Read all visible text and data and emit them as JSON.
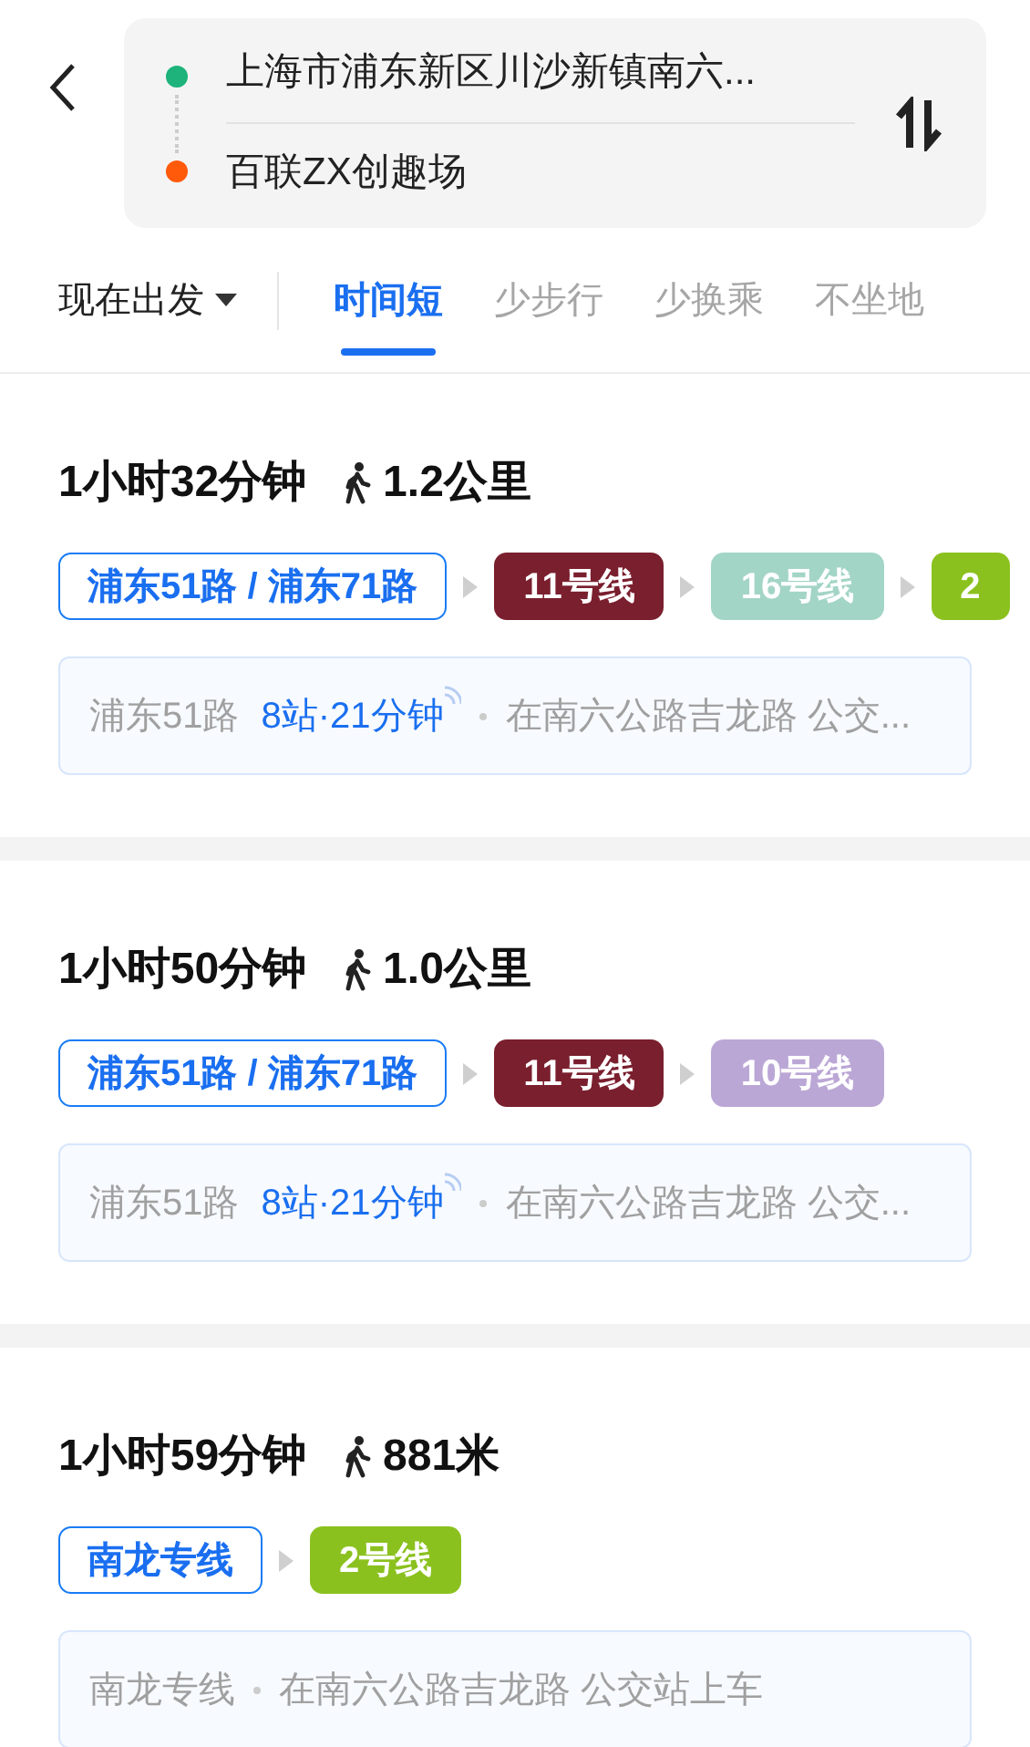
{
  "header": {
    "origin": "上海市浦东新区川沙新镇南六...",
    "destination": "百联ZX创趣场"
  },
  "depart": {
    "label": "现在出发"
  },
  "tabs": [
    {
      "label": "时间短",
      "selected": true
    },
    {
      "label": "少步行",
      "selected": false
    },
    {
      "label": "少换乘",
      "selected": false
    },
    {
      "label": "不坐地",
      "selected": false
    }
  ],
  "routes": [
    {
      "duration": "1小时32分钟",
      "walk": "1.2公里",
      "segments": [
        {
          "kind": "bus",
          "label": "浦东51路 / 浦东71路"
        },
        {
          "kind": "metro",
          "label": "11号线",
          "color": "#7a1f2e"
        },
        {
          "kind": "metro",
          "label": "16号线",
          "color": "#a3d5c6"
        },
        {
          "kind": "metro",
          "label": "2",
          "color": "#8bc11f"
        }
      ],
      "detail": {
        "line": "浦东51路",
        "stats": "8站·21分钟",
        "note": "在南六公路吉龙路 公交..."
      }
    },
    {
      "duration": "1小时50分钟",
      "walk": "1.0公里",
      "segments": [
        {
          "kind": "bus",
          "label": "浦东51路 / 浦东71路"
        },
        {
          "kind": "metro",
          "label": "11号线",
          "color": "#7a1f2e"
        },
        {
          "kind": "metro",
          "label": "10号线",
          "color": "#bba7d6"
        }
      ],
      "detail": {
        "line": "浦东51路",
        "stats": "8站·21分钟",
        "note": "在南六公路吉龙路 公交..."
      }
    },
    {
      "duration": "1小时59分钟",
      "walk": "881米",
      "segments": [
        {
          "kind": "bus",
          "label": "南龙专线"
        },
        {
          "kind": "metro",
          "label": "2号线",
          "color": "#8bc11f"
        }
      ],
      "detail": {
        "line": "南龙专线",
        "note": "在南六公路吉龙路 公交站上车"
      }
    }
  ]
}
